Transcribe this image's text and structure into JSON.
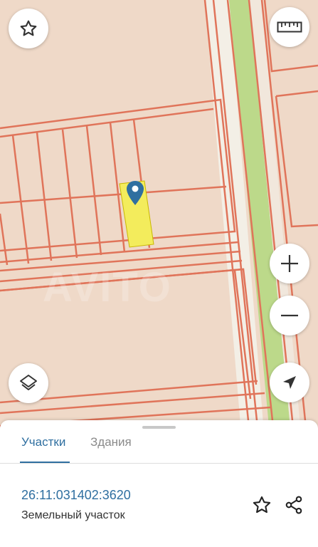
{
  "map": {
    "watermark": "AVITO",
    "colors": {
      "background": "#efd9c8",
      "parcel_border": "#e0745a",
      "road": "#f7f7f2",
      "green_strip": "#bcd98a",
      "selected_parcel": "#f3ec5c",
      "marker": "#2f6fa0"
    }
  },
  "controls": {
    "favorite_icon": "star-icon",
    "ruler_icon": "ruler-icon",
    "zoom_in_icon": "plus-icon",
    "zoom_out_icon": "minus-icon",
    "locate_icon": "navigation-arrow-icon",
    "layers_icon": "layers-icon"
  },
  "sheet": {
    "tabs": [
      {
        "label": "Участки",
        "active": true
      },
      {
        "label": "Здания",
        "active": false
      }
    ],
    "parcel": {
      "cadastral_number": "26:11:031402:3620",
      "type": "Земельный участок"
    }
  }
}
